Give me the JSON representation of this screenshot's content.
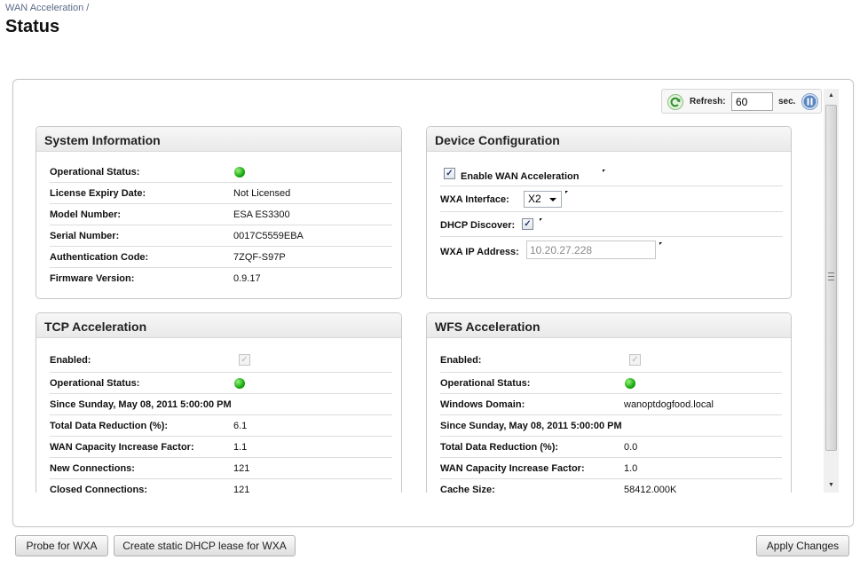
{
  "breadcrumb": "WAN Acceleration /",
  "page_title": "Status",
  "refresh": {
    "label": "Refresh:",
    "value": "60",
    "unit": "sec."
  },
  "system_info": {
    "title": "System Information",
    "rows": [
      {
        "label": "Operational Status:",
        "status": "green"
      },
      {
        "label": "License Expiry Date:",
        "value": "Not Licensed"
      },
      {
        "label": "Model Number:",
        "value": "ESA ES3300"
      },
      {
        "label": "Serial Number:",
        "value": "0017C5559EBA"
      },
      {
        "label": "Authentication Code:",
        "value": "7ZQF-S97P"
      },
      {
        "label": "Firmware Version:",
        "value": "0.9.17"
      }
    ]
  },
  "device_config": {
    "title": "Device Configuration",
    "enable_label": "Enable WAN Acceleration",
    "enable_checked": true,
    "wxa_interface_label": "WXA Interface:",
    "wxa_interface_value": "X2",
    "dhcp_label": "DHCP Discover:",
    "dhcp_checked": true,
    "ip_label": "WXA IP Address:",
    "ip_value": "10.20.27.228"
  },
  "tcp": {
    "title": "TCP Acceleration",
    "enabled_label": "Enabled:",
    "op_status_label": "Operational Status:",
    "since": "Since Sunday, May 08, 2011 5:00:00 PM",
    "rows": [
      {
        "label": "Total Data Reduction (%):",
        "value": "6.1"
      },
      {
        "label": "WAN Capacity Increase Factor:",
        "value": "1.1"
      },
      {
        "label": "New Connections:",
        "value": "121"
      },
      {
        "label": "Closed Connections:",
        "value": "121"
      }
    ]
  },
  "wfs": {
    "title": "WFS Acceleration",
    "enabled_label": "Enabled:",
    "op_status_label": "Operational Status:",
    "domain_label": "Windows Domain:",
    "domain_value": "wanoptdogfood.local",
    "since": "Since Sunday, May 08, 2011 5:00:00 PM",
    "rows": [
      {
        "label": "Total Data Reduction (%):",
        "value": "0.0"
      },
      {
        "label": "WAN Capacity Increase Factor:",
        "value": "1.0"
      },
      {
        "label": "Cache Size:",
        "value": "58412.000K"
      }
    ]
  },
  "buttons": {
    "probe": "Probe for WXA",
    "create_dhcp": "Create static DHCP lease for WXA",
    "apply": "Apply Changes"
  },
  "colors": {
    "status_ok": "#16a90f",
    "title_link": "#5a6a87",
    "accent_icon": "#2f8f2f"
  }
}
